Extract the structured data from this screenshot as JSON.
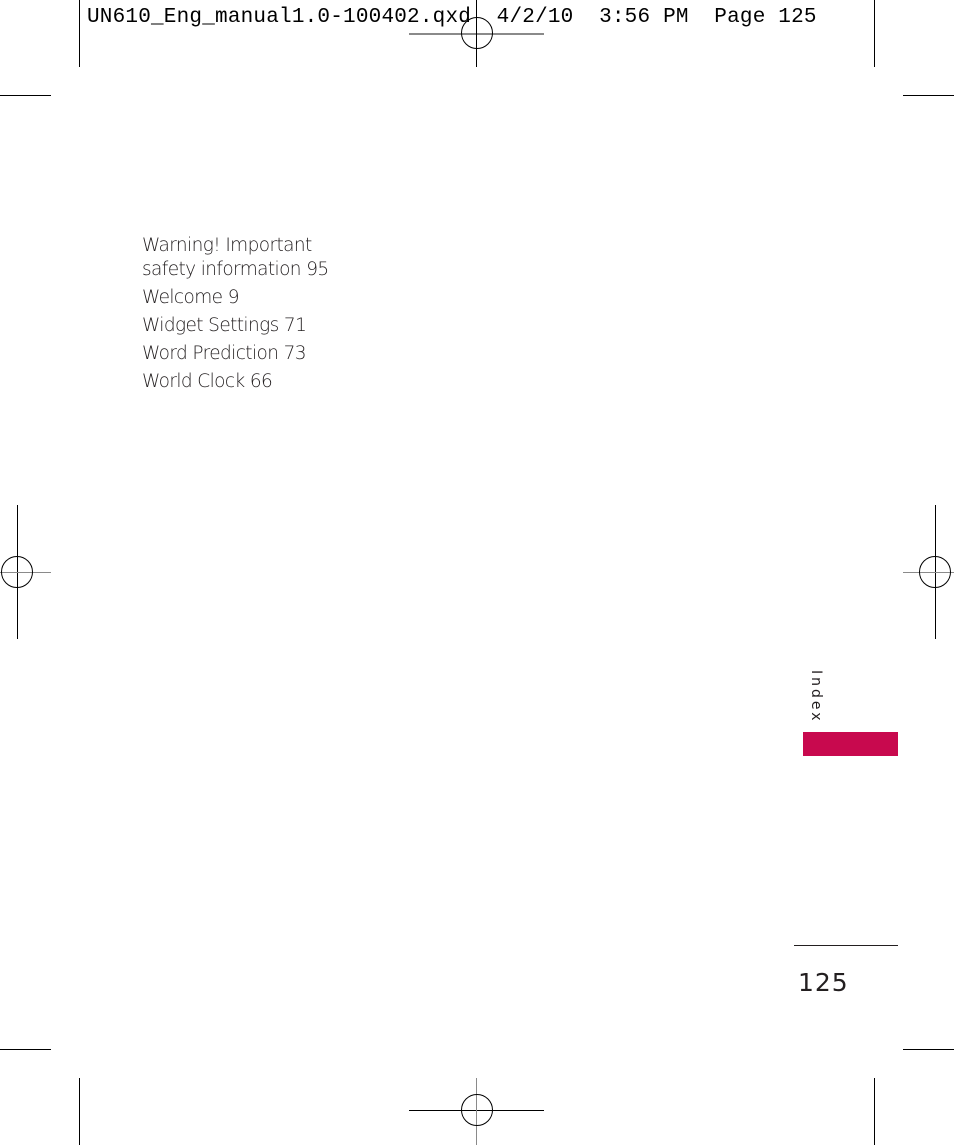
{
  "slug_line": "UN610_Eng_manual1.0-100402.qxd  4/2/10  3:56 PM  Page 125",
  "index_entries": [
    "Warning! Important safety information 95",
    "Welcome 9",
    "Widget Settings 71",
    "Word Prediction 73",
    "World Clock 66"
  ],
  "index_entry_lines": {
    "warning_line1": "Warning! Important",
    "warning_line2": "safety information 95"
  },
  "section_tab": {
    "label": "Index",
    "color": "#c8094e"
  },
  "page_number": "125"
}
